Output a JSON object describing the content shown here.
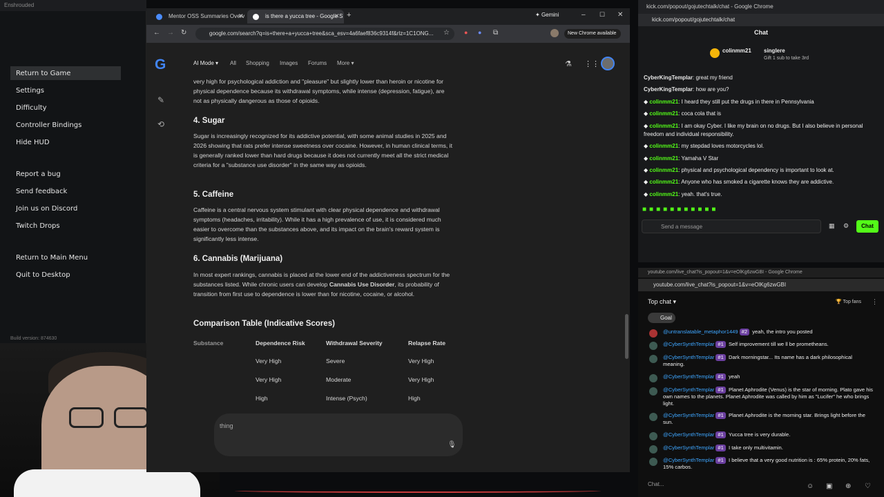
{
  "game_window": {
    "title": "Enshrouded",
    "menu": [
      "Return to Game",
      "Settings",
      "Difficulty",
      "Controller Bindings",
      "Hide HUD",
      "Report a bug",
      "Send feedback",
      "Join us on Discord",
      "Twitch Drops",
      "Return to Main Menu",
      "Quit to Desktop"
    ],
    "build": "Build version: 874630"
  },
  "browser": {
    "tabs": [
      "Mentor OSS Summaries Overv",
      "is there a yucca tree - Google S"
    ],
    "gemini_label": "Gemini",
    "url": "google.com/search?q=is+there+a+yucca+tree&sca_esv=4a6faef836c9314f&rlz=1C1ONG...",
    "new_chrome": "New Chrome available",
    "nav": [
      "AI Mode",
      "All",
      "Shopping",
      "Images",
      "Forums",
      "More"
    ],
    "search_placeholder": "thing"
  },
  "article": {
    "p0": "very high for psychological addiction and \"pleasure\" but slightly lower than heroin or nicotine for physical dependence because its withdrawal symptoms, while intense (depression, fatigue), are not as physically dangerous as those of opioids.",
    "h4": "4. Sugar",
    "p4": "Sugar is increasingly recognized for its addictive potential, with some animal studies in 2025 and 2026 showing that rats prefer intense sweetness over cocaine. However, in human clinical terms, it is generally ranked lower than hard drugs because it does not currently meet all the strict medical criteria for a \"substance use disorder\" in the same way as opioids.",
    "h5": "5. Caffeine",
    "p5": "Caffeine is a central nervous system stimulant with clear physical dependence and withdrawal symptoms (headaches, irritability). While it has a high prevalence of use, it is considered much easier to overcome than the substances above, and its impact on the brain's reward system is significantly less intense.",
    "h6": "6. Cannabis (Marijuana)",
    "p6a": "In most expert rankings, cannabis is placed at the lower end of the addictiveness spectrum for the substances listed. While chronic users can develop ",
    "p6b": "Cannabis Use Disorder",
    "p6c": ", its probability of transition from first use to dependence is lower than for nicotine, cocaine, or alcohol.",
    "table_title": "Comparison Table (Indicative Scores)",
    "columns": [
      "Substance",
      "Dependence Risk",
      "Withdrawal Severity",
      "Relapse Rate"
    ],
    "rows": [
      [
        "Very High",
        "Severe",
        "Very High"
      ],
      [
        "Very High",
        "Moderate",
        "Very High"
      ],
      [
        "High",
        "Intense (Psych)",
        "High"
      ]
    ]
  },
  "kick": {
    "window_title": "kick.com/popout/gojutechtalk/chat - Google Chrome",
    "url": "kick.com/popout/gojutechtalk/chat",
    "header": "Chat",
    "gift_user": "colinmm21",
    "gift_user2": "singlere",
    "gift_text": "Gift 1 sub to take 3rd",
    "messages": [
      {
        "user": "CyberKingTemplar",
        "text": "great my friend"
      },
      {
        "user": "CyberKingTemplar",
        "text": "how are you?"
      },
      {
        "user": "colinmm21",
        "text": "I heard they still put the drugs in there in Pennsylvania"
      },
      {
        "user": "colinmm21",
        "text": "coca cola that is"
      },
      {
        "user": "colinmm21",
        "text": "I am okay Cyber. I like my brain  on no drugs. But I also believe in personal freedom and individual responsibility."
      },
      {
        "user": "colinmm21",
        "text": "my stepdad loves motorcycles lol."
      },
      {
        "user": "colinmm21",
        "text": "Yamaha V Star"
      },
      {
        "user": "colinmm21",
        "text": "physical and psychological dependency is important to look at."
      },
      {
        "user": "colinmm21",
        "text": "Anyone who has smoked a cigarette knows they are addictive."
      },
      {
        "user": "colinmm21",
        "text": "yeah. that's true."
      }
    ],
    "input_placeholder": "Send a message",
    "chat_button": "Chat"
  },
  "youtube": {
    "window_title": "youtube.com/live_chat?is_popout=1&v=eOlKg6zwGBI - Google Chrome",
    "url": "youtube.com/live_chat?is_popout=1&v=eOlKg6zwGBI",
    "top_chat": "Top chat",
    "top_fans": "Top fans",
    "goal": "Goal",
    "messages": [
      {
        "user": "@untranslatable_metaphor1449",
        "badge": "#2",
        "text": "yeah, the intro you posted"
      },
      {
        "user": "@CyberSynthTemplar",
        "badge": "#1",
        "text": "Self improvement till we ll be prometheans."
      },
      {
        "user": "@CyberSynthTemplar",
        "badge": "#1",
        "text": "Dark morningstar... Its name has a dark philosophical meaning."
      },
      {
        "user": "@CyberSynthTemplar",
        "badge": "#1",
        "text": "yeah"
      },
      {
        "user": "@CyberSynthTemplar",
        "badge": "#1",
        "text": "Planet Aphrodite (Venus) is the star of morning. Plato gave his own names to the planets. Planet Aphrodite was called by him as \"Lucifer\" he who brings light."
      },
      {
        "user": "@CyberSynthTemplar",
        "badge": "#1",
        "text": "Planet Aphrodite is the morning star. Brings light before the sun."
      },
      {
        "user": "@CyberSynthTemplar",
        "badge": "#1",
        "text": "Yucca tree is very durable."
      },
      {
        "user": "@CyberSynthTemplar",
        "badge": "#1",
        "text": "I take only multivitamin."
      },
      {
        "user": "@CyberSynthTemplar",
        "badge": "#1",
        "text": "I believe that a very good nutrition is : 65% protein, 20% fats, 15% carbos."
      }
    ],
    "input_placeholder": "Chat..."
  }
}
